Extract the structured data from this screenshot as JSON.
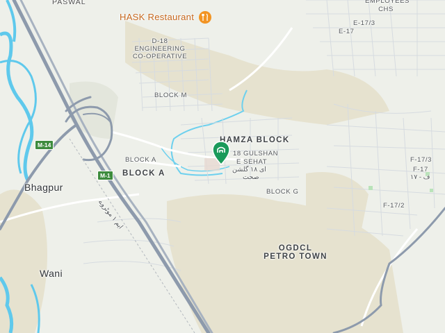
{
  "map": {
    "colors": {
      "land": "#eef0ea",
      "tan": "#e6e2cf",
      "water": "#5fc9ec",
      "motorway": "#8d9aac",
      "road": "#ffffff",
      "pin": "#1a9a5a",
      "poi": "#f29423"
    },
    "labels": {
      "paswal": "PASWAL",
      "hask": "HASK Restaurant",
      "d18_line1": "D-18",
      "d18_line2": "ENGINEERING",
      "d18_line3": "CO-OPERATIVE",
      "employees_line1": "EMPLOYEES",
      "employees_line2": "CHS",
      "e17_3": "E-17/3",
      "e17": "E-17",
      "block_m": "BLOCK M",
      "hamza_block": "HAMZA BLOCK",
      "gulshan_line1": "18 GULSHAN",
      "gulshan_line2": "E SEHAT",
      "gulshan_urdu_line1": "ای ۱۸ گلشن",
      "gulshan_urdu_line2": "صحت",
      "block_a_small": "BLOCK A",
      "block_a_big": "BLOCK A",
      "block_g": "BLOCK G",
      "f17_3": "F-17/3",
      "f17": "F-17",
      "f17_urdu": "ف - ۱۷",
      "f17_2": "F-17/2",
      "ogdcl_line1": "OGDCL",
      "ogdcl_line2": "PETRO TOWN",
      "bhagpur": "Bhagpur",
      "wani": "Wani",
      "motorway_urdu": "ایم ۱ موٹروے"
    },
    "shields": {
      "m14": "M-14",
      "m1": "M-1"
    },
    "icons": {
      "poi": "restaurant-icon",
      "pin": "location-pin-icon"
    }
  }
}
